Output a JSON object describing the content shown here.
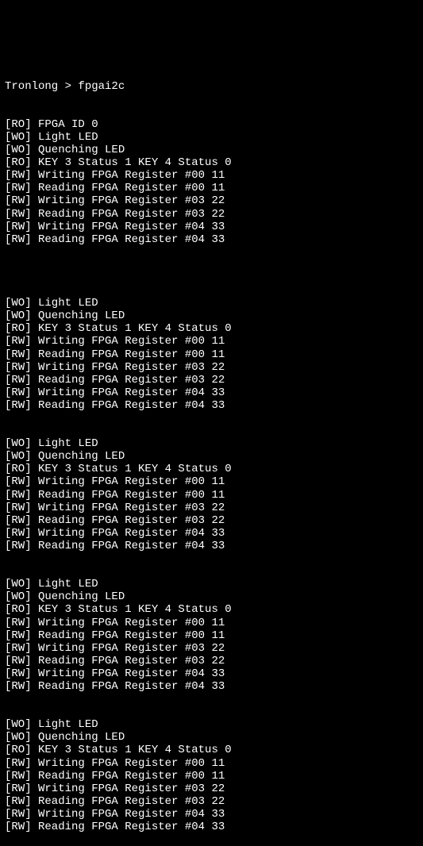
{
  "prompt": "Tronlong > fpgai2c",
  "header_lines": [
    "[RO] FPGA ID 0",
    "[WO] Light LED",
    "[WO] Quenching LED",
    "[RO] KEY 3 Status 1 KEY 4 Status 0",
    "[RW] Writing FPGA Register #00 11",
    "[RW] Reading FPGA Register #00 11",
    "[RW] Writing FPGA Register #03 22",
    "[RW] Reading FPGA Register #03 22",
    "[RW] Writing FPGA Register #04 33",
    "[RW] Reading FPGA Register #04 33"
  ],
  "repeat_block": [
    "[WO] Light LED",
    "[WO] Quenching LED",
    "[RO] KEY 3 Status 1 KEY 4 Status 0",
    "[RW] Writing FPGA Register #00 11",
    "[RW] Reading FPGA Register #00 11",
    "[RW] Writing FPGA Register #03 22",
    "[RW] Reading FPGA Register #03 22",
    "[RW] Writing FPGA Register #04 33",
    "[RW] Reading FPGA Register #04 33"
  ],
  "repeat_count": 4
}
